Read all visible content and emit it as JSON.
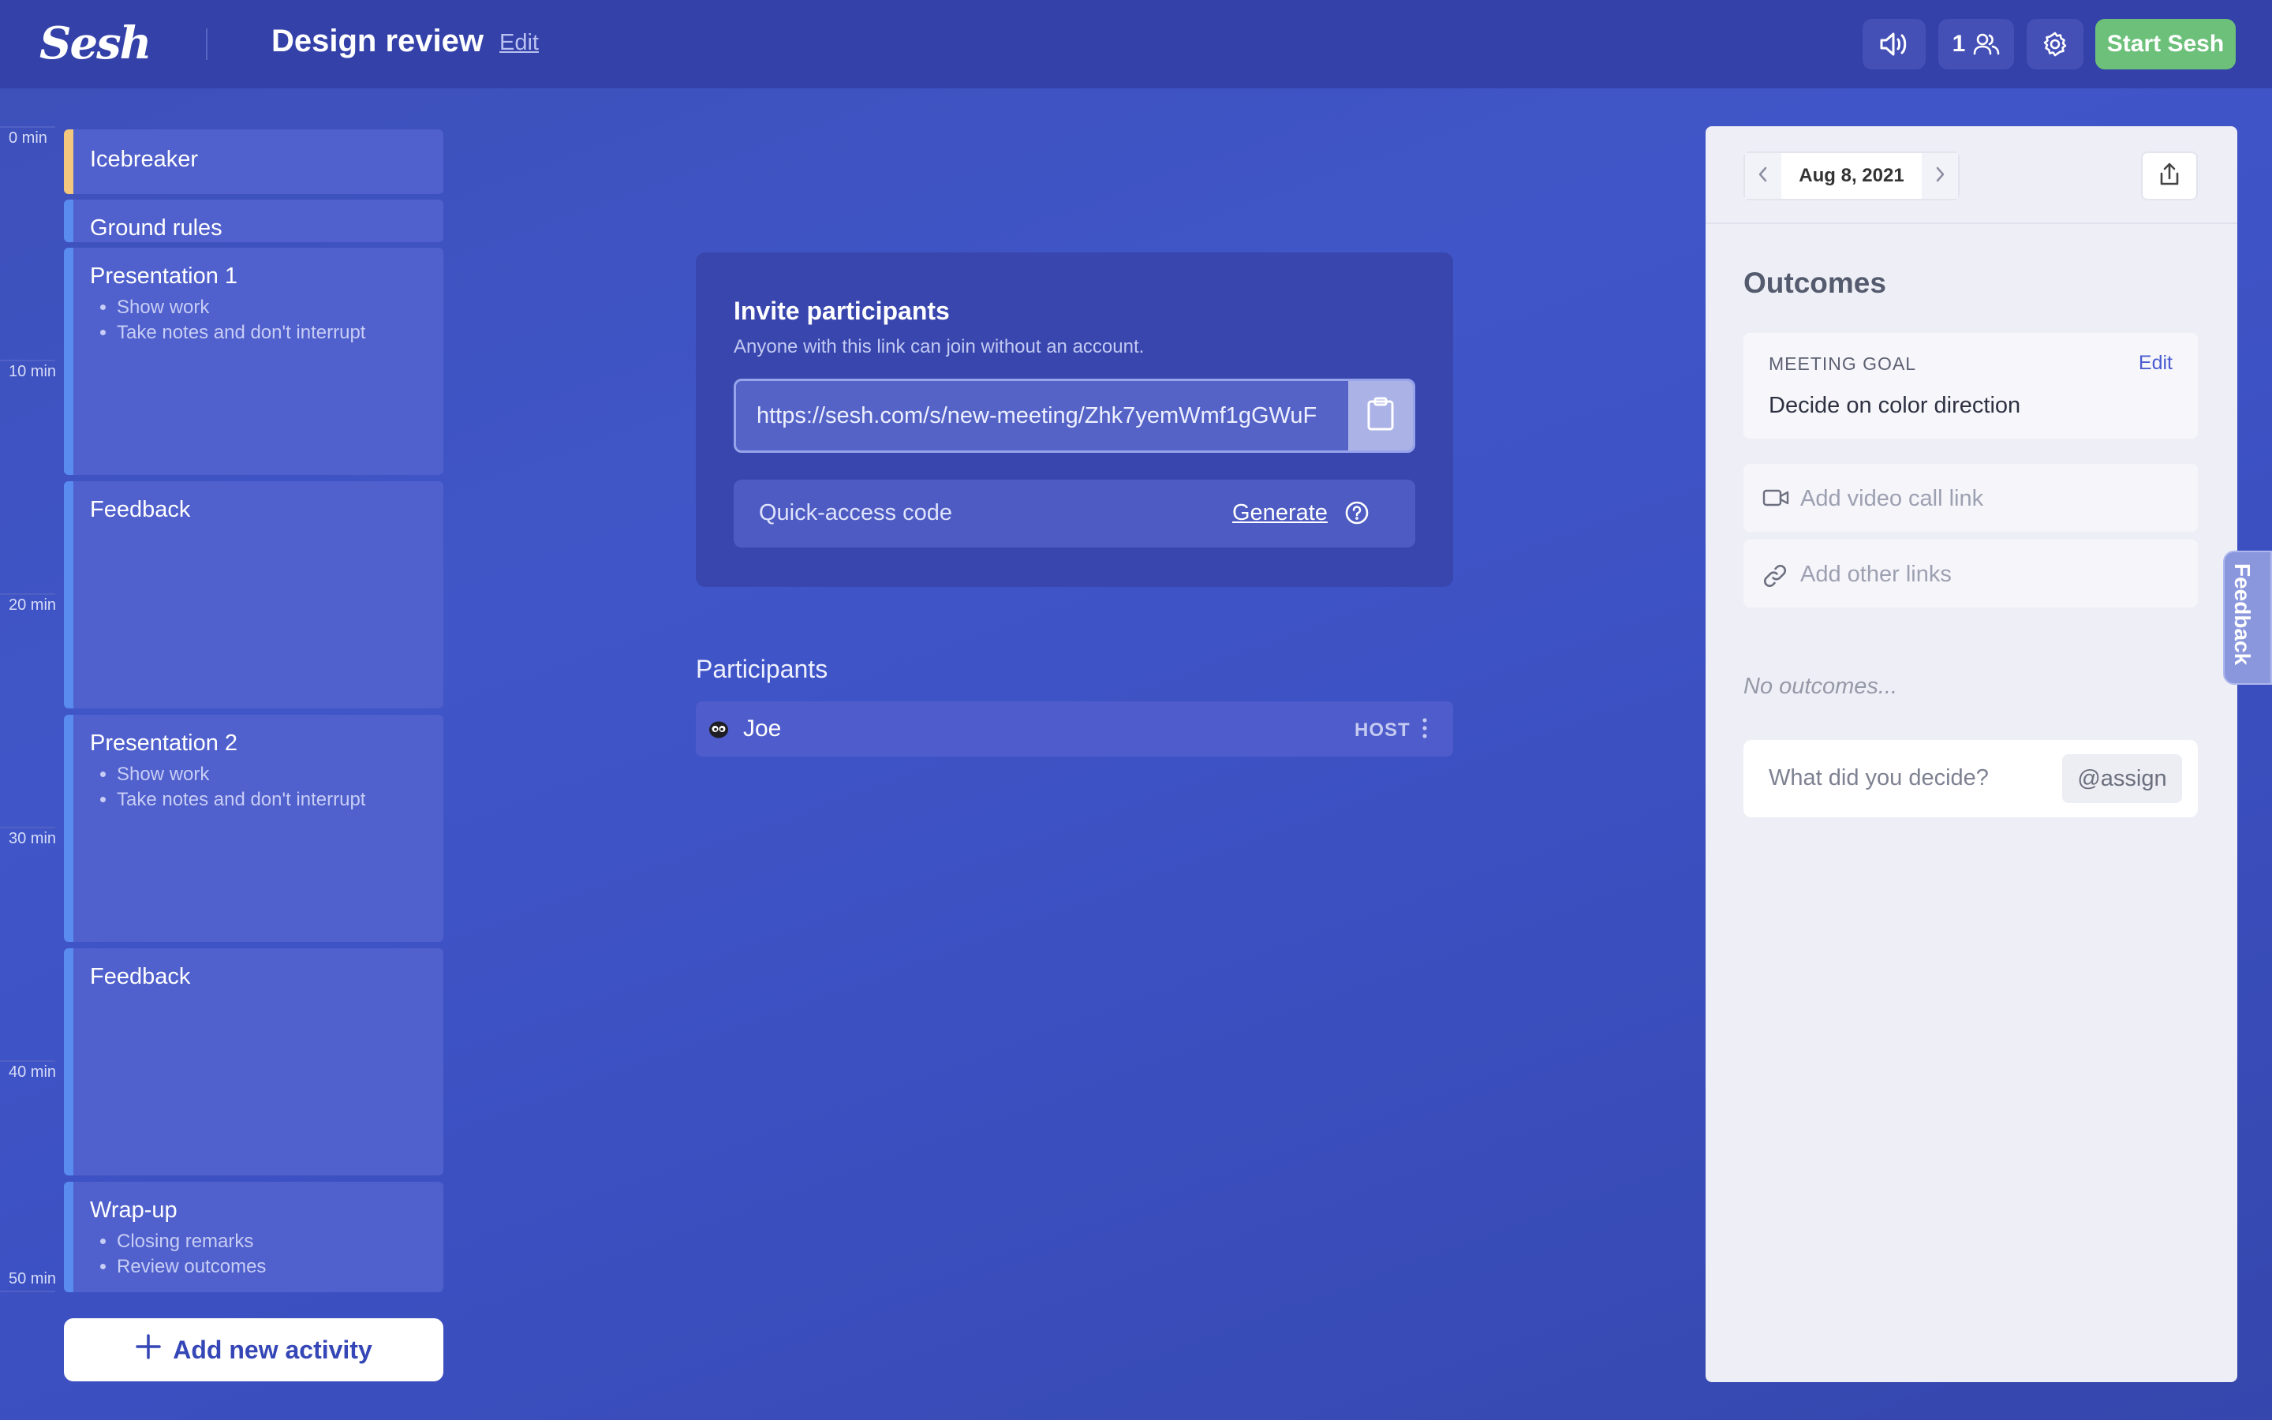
{
  "header": {
    "logo": "Sesh",
    "title": "Design review",
    "edit_label": "Edit",
    "participant_count": "1",
    "start_label": "Start Sesh"
  },
  "timeline": {
    "labels": [
      "0 min",
      "10 min",
      "20 min",
      "30 min",
      "40 min",
      "50 min"
    ]
  },
  "activities": [
    {
      "name": "Icebreaker",
      "notes": []
    },
    {
      "name": "Ground rules",
      "notes": []
    },
    {
      "name": "Presentation 1",
      "notes": [
        "Show work",
        "Take notes and don't interrupt"
      ]
    },
    {
      "name": "Feedback",
      "notes": []
    },
    {
      "name": "Presentation 2",
      "notes": [
        "Show work",
        "Take notes and don't interrupt"
      ]
    },
    {
      "name": "Feedback",
      "notes": []
    },
    {
      "name": "Wrap-up",
      "notes": [
        "Closing remarks",
        "Review outcomes"
      ]
    }
  ],
  "add_activity_label": "Add new activity",
  "invite": {
    "title": "Invite participants",
    "subtitle": "Anyone with this link can join without an account.",
    "link": "https://sesh.com/s/new-meeting/Zhk7yemWmf1gGWuF",
    "code_label": "Quick-access code",
    "generate_label": "Generate"
  },
  "participants": {
    "heading": "Participants",
    "list": [
      {
        "name": "Joe",
        "role": "HOST"
      }
    ]
  },
  "panel": {
    "date": "Aug 8, 2021",
    "outcomes_heading": "Outcomes",
    "goal_label": "MEETING GOAL",
    "goal_edit": "Edit",
    "goal_value": "Decide on color direction",
    "video_link_placeholder": "Add video call link",
    "other_links_placeholder": "Add other links",
    "no_outcomes": "No outcomes...",
    "decide_placeholder": "What did you decide?",
    "assign_label": "@assign"
  },
  "feedback_tab": "Feedback",
  "colors": {
    "accent_green": "#6cc07a",
    "activity_bar_blue": "#5a8cf0",
    "activity_bar_warm": "#f3c77d"
  }
}
